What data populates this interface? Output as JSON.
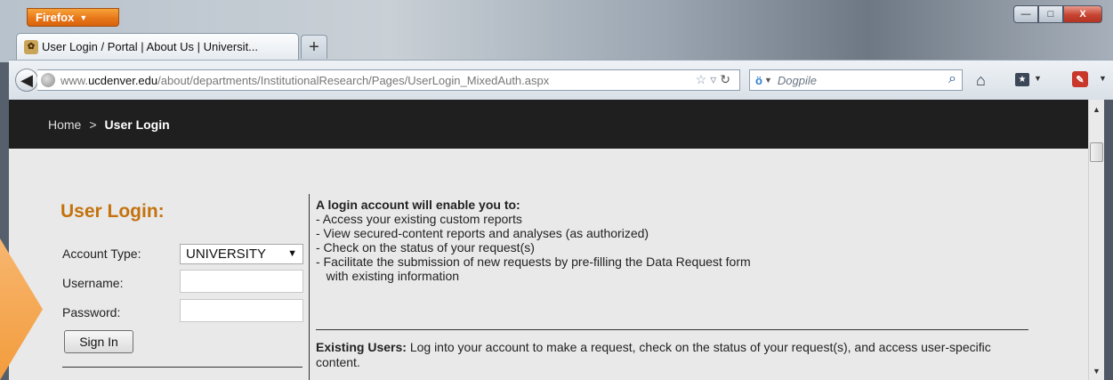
{
  "browser": {
    "menu_label": "Firefox",
    "tab_title": "User Login / Portal | About Us | Universit...",
    "new_tab": "+",
    "url_prefix": "www.",
    "url_host": "ucdenver.edu",
    "url_path": "/about/departments/InstitutionalResearch/Pages/UserLogin_MixedAuth.aspx",
    "search_placeholder": "Dogpile",
    "window_controls": {
      "minimize": "—",
      "maximize": "□",
      "close": "X"
    }
  },
  "breadcrumb": {
    "home": "Home",
    "separator": ">",
    "current": "User Login"
  },
  "login_form": {
    "title": "User Login:",
    "account_type_label": "Account Type:",
    "account_type_value": "UNIVERSITY",
    "username_label": "Username:",
    "password_label": "Password:",
    "sign_in_label": "Sign In"
  },
  "info": {
    "heading": "A login account will enable you to:",
    "benefits": [
      "-  Access your existing custom reports",
      "-  View secured-content reports and analyses (as authorized)",
      "-  Check on the status of your request(s)",
      "-  Facilitate the submission of new requests by pre-filling the Data Request form",
      "   with existing information"
    ],
    "existing_users_label": "Existing Users:",
    "existing_users_text": "Log into your account to make a request, check on the status of your request(s), and access user-specific content."
  },
  "colors": {
    "login_title": "#c4720e",
    "breadcrumb_bar": "#1f1f1f",
    "firefox_button": "#e8771a",
    "callout_arrow": "#f39c3c"
  }
}
